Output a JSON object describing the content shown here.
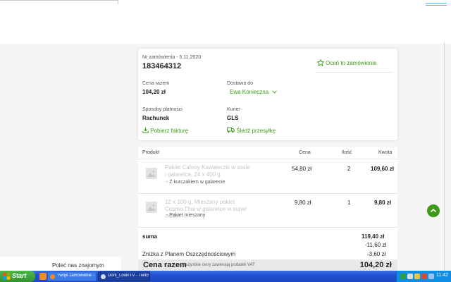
{
  "order": {
    "number_label": "Nr zamówienia - 5.11.2020",
    "number": "183464312",
    "rate_label": "Oceń to zamówienie",
    "price_label": "Cena razem",
    "price": "104,20 zł",
    "delivery_label": "Dostawa do",
    "delivery_person": "Ewa Konieczna",
    "payment_label": "Sposoby płatności",
    "payment": "Rachunek",
    "courier_label": "Kurier",
    "courier": "GLS",
    "invoice_link": "Pobierz fakturę",
    "track_link": "Śledź przesyłkę"
  },
  "table": {
    "headers": {
      "product": "Produkt",
      "price": "Cena",
      "qty": "Ilość",
      "amount": "Kwota"
    },
    "rows": [
      {
        "name": "Pakiet Cafeoy Kawałeczki w sosie i galaretce, 24 x 400 g",
        "variant": "- Z kurczakiem w galarecie",
        "price": "54,80 zł",
        "qty": "2",
        "amount": "109,60 zł"
      },
      {
        "name": "12 x 100 g, Mieszany pakiet Cosma Thai w galaretce w super cenie!",
        "variant": "- Pakiet mieszany",
        "price": "9,80 zł",
        "qty": "1",
        "amount": "9,80 zł"
      }
    ]
  },
  "summary": {
    "sum_label": "suma",
    "sum_value": "119,40 zł",
    "discount1": "-11,60 zł",
    "savings_label": "Zniżka z Planem Oszczędnościowym",
    "savings_value": "-3,60 zł",
    "total_label": "Cena razem",
    "total_note": "Wszystkie ceny zawierają podatek VAT",
    "total_value": "104,20 zł"
  },
  "sidebar": {
    "refer_label": "Poleć nas znajomym"
  },
  "taskbar": {
    "start_label": "Start",
    "tasks": [
      {
        "label": "Twoje zamówienie - ..."
      },
      {
        "label": "Dont_Look!TV - Twitch..."
      }
    ],
    "clock": "11:42"
  },
  "colors": {
    "accent": "#3d9a17",
    "taskbar": "#245edc",
    "start": "#3c9a38"
  }
}
